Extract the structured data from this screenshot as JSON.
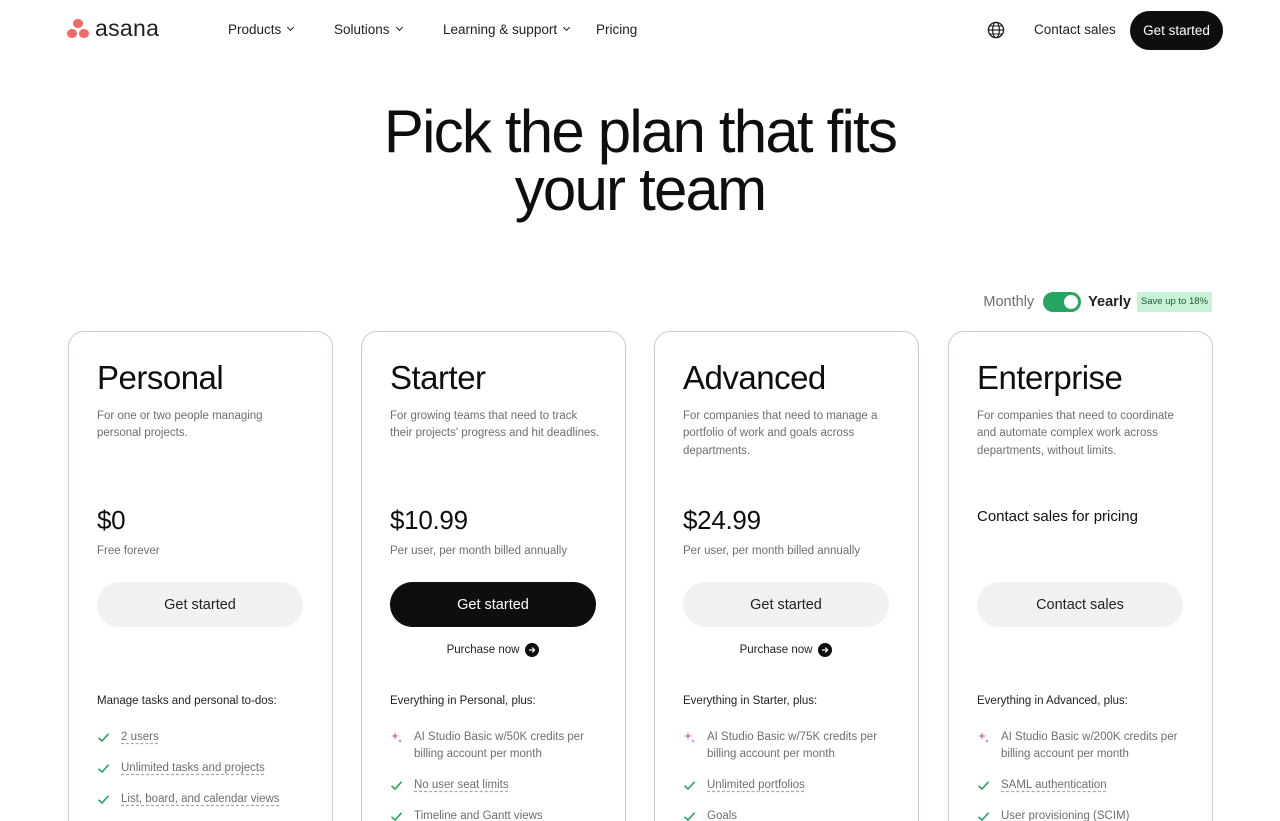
{
  "header": {
    "logo_text": "asana",
    "nav": [
      {
        "label": "Products"
      },
      {
        "label": "Solutions"
      },
      {
        "label": "Learning & support"
      },
      {
        "label": "Pricing"
      }
    ],
    "contact_label": "Contact sales",
    "cta_label": "Get started"
  },
  "hero": {
    "line1": "Pick the plan that fits",
    "line2": "your team"
  },
  "billing": {
    "monthly_label": "Monthly",
    "yearly_label": "Yearly",
    "selected": "Yearly",
    "save_badge": "Save up to 18%"
  },
  "colors": {
    "logo": "#f06a6a",
    "toggle": "#25a55f",
    "badge": "#c8f2d8",
    "primary_button": "#0d0e10"
  },
  "plans": [
    {
      "title": "Personal",
      "description": "For one or two people managing personal projects.",
      "price": "$0",
      "price_note": "Free forever",
      "button": "Get started",
      "features_head": "Manage tasks and personal to-dos:",
      "features": [
        {
          "icon": "check-icon",
          "text": "2 users"
        },
        {
          "icon": "check-icon",
          "text": "Unlimited tasks and projects"
        },
        {
          "icon": "check-icon",
          "text": "List, board, and calendar views"
        }
      ]
    },
    {
      "title": "Starter",
      "description": "For growing teams that need to track their projects' progress and hit deadlines.",
      "price": "$10.99",
      "price_note": "Per user, per month billed annually",
      "button": "Get started",
      "purchase": "Purchase now",
      "features_head": "Everything in Personal, plus:",
      "features": [
        {
          "icon": "sparkle-icon",
          "text": "AI Studio Basic w/50K credits per billing account per month"
        },
        {
          "icon": "check-icon",
          "text": "No user seat limits"
        },
        {
          "icon": "check-icon",
          "text": "Timeline and Gantt views"
        }
      ]
    },
    {
      "title": "Advanced",
      "description": "For companies that need to manage a portfolio of work and goals across departments.",
      "price": "$24.99",
      "price_note": "Per user, per month billed annually",
      "button": "Get started",
      "purchase": "Purchase now",
      "features_head": "Everything in Starter, plus:",
      "features": [
        {
          "icon": "sparkle-icon",
          "text": "AI Studio Basic w/75K credits per billing account per month"
        },
        {
          "icon": "check-icon",
          "text": "Unlimited portfolios"
        },
        {
          "icon": "check-icon",
          "text": "Goals"
        }
      ]
    },
    {
      "title": "Enterprise",
      "description": "For companies that need to coordinate and automate complex work across departments, without limits.",
      "price_contact": "Contact sales for pricing",
      "button": "Contact sales",
      "features_head": "Everything in Advanced, plus:",
      "features": [
        {
          "icon": "sparkle-icon",
          "text": "AI Studio Basic w/200K credits per billing account per month"
        },
        {
          "icon": "check-icon",
          "text": "SAML authentication"
        },
        {
          "icon": "check-icon",
          "text": "User provisioning (SCIM)"
        }
      ]
    }
  ]
}
